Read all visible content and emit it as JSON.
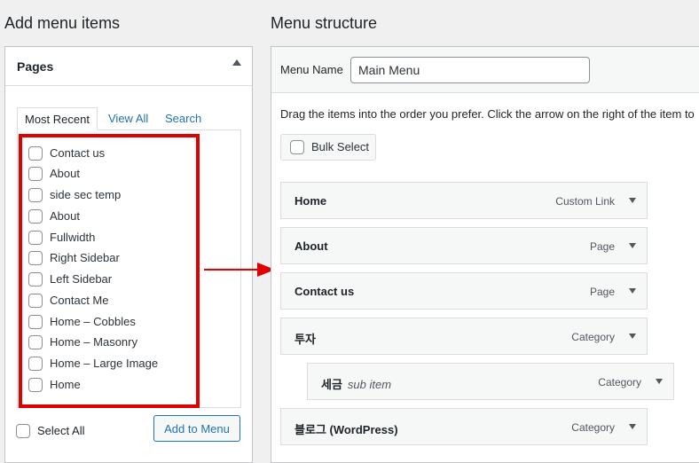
{
  "left": {
    "heading": "Add menu items",
    "panel_title": "Pages",
    "tabs": [
      "Most Recent",
      "View All",
      "Search"
    ],
    "pages": [
      "Contact us",
      "About",
      "side sec temp",
      "About",
      "Fullwidth",
      "Right Sidebar",
      "Left Sidebar",
      "Contact Me",
      "Home – Cobbles",
      "Home – Masonry",
      "Home – Large Image",
      "Home"
    ],
    "select_all": "Select All",
    "add_button": "Add to Menu"
  },
  "right": {
    "heading": "Menu structure",
    "menu_name_label": "Menu Name",
    "menu_name_value": "Main Menu",
    "instructions": "Drag the items into the order you prefer. Click the arrow on the right of the item to",
    "bulk_select": "Bulk Select",
    "items": [
      {
        "title": "Home",
        "subtitle": "",
        "type": "Custom Link"
      },
      {
        "title": "About",
        "subtitle": "",
        "type": "Page"
      },
      {
        "title": "Contact us",
        "subtitle": "",
        "type": "Page"
      },
      {
        "title": "투자",
        "subtitle": "",
        "type": "Category"
      },
      {
        "title": "세금",
        "subtitle": "sub item",
        "type": "Category"
      },
      {
        "title": "블로그 (WordPress)",
        "subtitle": "",
        "type": "Category"
      }
    ]
  },
  "colors": {
    "highlight": "#e00000",
    "link": "#2271b1"
  }
}
